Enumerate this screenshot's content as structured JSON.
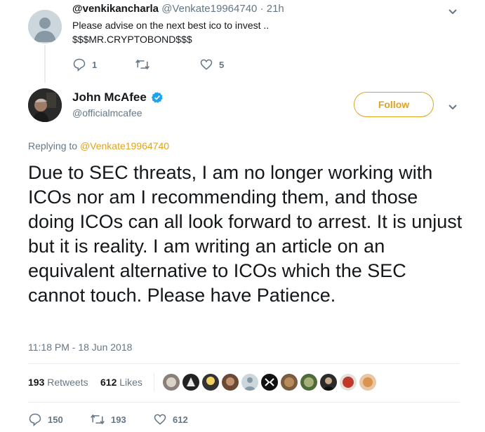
{
  "reply": {
    "display_name": "@venkikancharla",
    "handle": "@Venkate19964740",
    "time": "· 21h",
    "text_line1": "Please advise on the next best ico to invest ..",
    "text_line2": "$$$MR.CRYPTOBOND$$$",
    "reply_count": "1",
    "retweet_count": "",
    "like_count": "5"
  },
  "main": {
    "name": "John McAfee",
    "handle": "@officialmcafee",
    "follow_label": "Follow",
    "replying_prefix": "Replying to",
    "replying_to": "@Venkate19964740",
    "text": "Due to SEC threats, I am no longer working with ICOs nor am I recommending them, and those doing ICOs can all look forward to arrest. It is unjust but it is reality. I am writing an article on an equivalent alternative to ICOs which the SEC cannot touch. Please have Patience.",
    "timestamp": "11:18 PM - 18 Jun 2018",
    "retweets_count": "193",
    "retweets_label": "Retweets",
    "likes_count": "612",
    "likes_label": "Likes",
    "footer_reply_count": "150",
    "footer_retweet_count": "193",
    "footer_like_count": "612"
  },
  "colors": {
    "accent": "#e0a31c",
    "verified": "#1da1f2",
    "muted": "#657786"
  },
  "icons": [
    "chevron-down-icon",
    "reply-icon",
    "retweet-icon",
    "heart-icon",
    "verified-badge-icon",
    "default-avatar-icon"
  ]
}
